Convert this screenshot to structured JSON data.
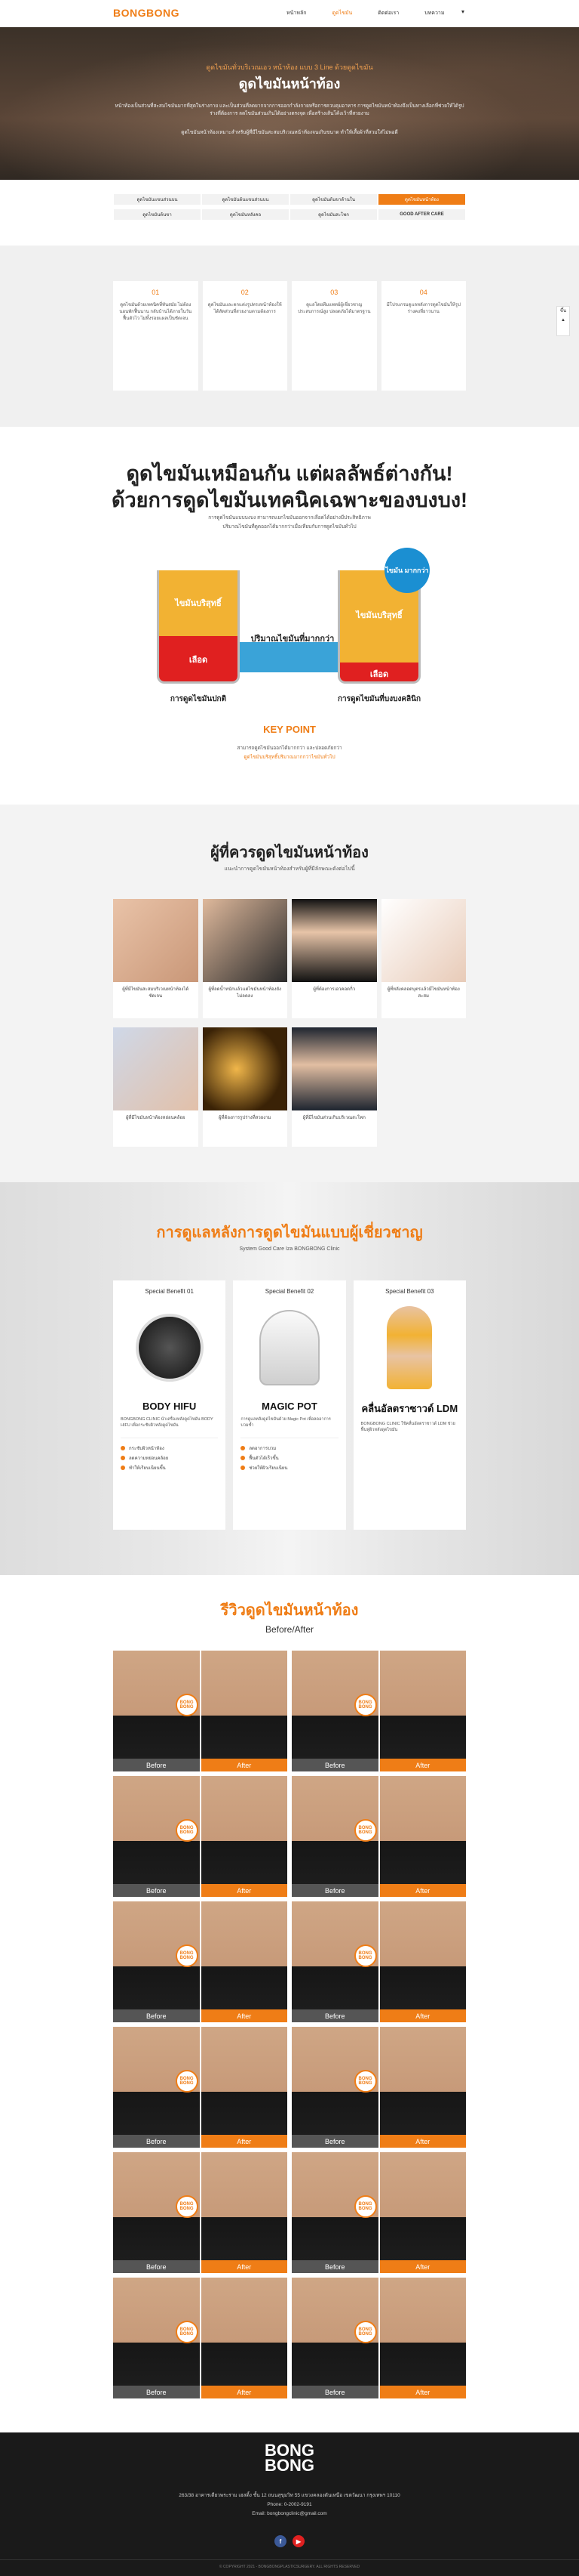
{
  "header": {
    "logo": "BONGBONG",
    "nav": [
      "หน้าหลัก",
      "ดูดไขมัน",
      "ติดต่อเรา",
      "บทความ",
      "▾"
    ]
  },
  "hero": {
    "subtitle": "ดูดไขมันทั่วบริเวณเอว หน้าท้อง แบบ 3 Line ด้วยดูดไขมัน",
    "title": "ดูดไขมันหน้าท้อง",
    "desc1": "หน้าท้องเป็นส่วนที่สะสมไขมันมากที่สุดในร่างกาย และเป็นส่วนที่ลดยากจากการออกกำลังกายหรือการควบคุมอาหาร การดูดไขมันหน้าท้องจึงเป็นทางเลือกที่ช่วยให้ได้รูปร่างที่ต้องการ ลดไขมันส่วนเกินได้อย่างตรงจุด เพื่อสร้างเส้นโค้งเว้าที่สวยงาม",
    "desc2": "ดูดไขมันหน้าท้องเหมาะสำหรับผู้ที่มีไขมันสะสมบริเวณหน้าท้องจนเกินขนาด ทำให้เสื้อผ้าที่สวมใส่ไม่พอดี"
  },
  "tabs": [
    {
      "label": "ดูดไขมันแขนส่วนบน",
      "active": false
    },
    {
      "label": "ดูดไขมันต้นแขนส่วนบน",
      "active": false
    },
    {
      "label": "ดูดไขมันต้นขาด้านใน",
      "active": false
    },
    {
      "label": "ดูดไขมันหน้าท้อง",
      "active": true
    },
    {
      "label": "ดูดไขมันต้นขา",
      "active": false
    },
    {
      "label": "ดูดไขมันหลังคอ",
      "active": false
    },
    {
      "label": "ดูดไขมันสะโพก",
      "active": false
    },
    {
      "label": "GOOD AFTER CARE",
      "active": false
    }
  ],
  "steps": [
    {
      "num": "01",
      "text": "ดูดไขมันด้วยเทคนิคที่ทันสมัย ไม่ต้องนอนพักฟื้นนาน กลับบ้านได้ภายในวัน ฟื้นตัวไว ไม่ทิ้งรอยแผลเป็นชัดเจน"
    },
    {
      "num": "02",
      "text": "ดูดไขมันและตกแต่งรูปทรงหน้าท้องให้ได้สัดส่วนที่สวยงามตามต้องการ"
    },
    {
      "num": "03",
      "text": "ดูแลโดยทีมแพทย์ผู้เชี่ยวชาญ ประสบการณ์สูง ปลอดภัยได้มาตรฐาน"
    },
    {
      "num": "04",
      "text": "มีโปรแกรมดูแลหลังการดูดไขมันให้รูปร่างคงที่ยาวนาน"
    }
  ],
  "side": {
    "up": "ขึ้น",
    "down": "▲"
  },
  "compare": {
    "heading1": "ดูดไขมันเหมือนกัน แต่ผลลัพธ์ต่างกัน!",
    "heading2": "ด้วยการดูดไขมันเทคนิคเฉพาะของบงบง!",
    "p1": "การดูดไขมันแบบบงบง สามารถแยกไขมันออกจากเลือดได้อย่างมีประสิทธิภาพ",
    "p2": "ปริมาณไขมันที่ดูดออกได้มากกว่าเมื่อเทียบกับการดูดไขมันทั่วไป",
    "fat_label": "ไขมันบริสุทธิ์",
    "blood_label": "เลือด",
    "middle_label": "ปริมาณไขมันที่มากกว่า",
    "badge": "ไขมัน มากกว่า",
    "left_caption": "การดูดไขมันปกติ",
    "right_caption": "การดูดไขมันที่บงบงคลินิก",
    "key_point": "KEY POINT",
    "kp_text1": "สามารถดูดไขมันออกได้มากกว่า และปลอดภัยกว่า",
    "kp_text2": "ดูดไขมันบริสุทธิ์ปริมาณมากกว่าไขมันทั่วไป"
  },
  "who": {
    "title": "ผู้ที่ควรดูดไขมันหน้าท้อง",
    "subtitle": "แนะนำการดูดไขมันหน้าท้องสำหรับผู้ที่มีลักษณะดังต่อไปนี้",
    "items": [
      "ผู้ที่มีไขมันสะสมบริเวณหน้าท้องได้ชัดเจน",
      "ผู้ที่ลดน้ำหนักแล้วแต่ไขมันหน้าท้องยังไม่ลดลง",
      "ผู้ที่ต้องการเอวคอดกิ่ว",
      "ผู้ที่หลังคลอดบุตรแล้วมีไขมันหน้าท้องสะสม",
      "ผู้ที่มีไขมันหน้าท้องหย่อนคล้อย",
      "ผู้ที่ต้องการรูปร่างที่สวยงาม",
      "ผู้ที่มีไขมันส่วนเกินบริเวณสะโพก"
    ]
  },
  "care": {
    "title": "การดูแลหลังการดูดไขมันแบบผู้เชี่ยวชาญ",
    "subtitle": "System Good Care Iza BONGBONG Clinic",
    "services": [
      {
        "benefit": "Special Benefit 01",
        "name": "BODY HIFU",
        "desc": "BONGBONG CLINIC นำเครื่องหลังดูดไขมัน BODY HIFU เพื่อกระชับผิวหลังดูดไขมัน",
        "points": [
          "กระชับผิวหน้าท้อง",
          "ลดความหย่อนคล้อย",
          "ทำให้เรียบเนียนขึ้น"
        ]
      },
      {
        "benefit": "Special Benefit 02",
        "name": "MAGIC POT",
        "desc": "การดูแลหลังดูดไขมันด้วย Magic Pot เพื่อลดอาการบวมช้ำ",
        "points": [
          "ลดอาการบวม",
          "ฟื้นตัวได้เร็วขึ้น",
          "ช่วยให้ผิวเรียบเนียน"
        ]
      },
      {
        "benefit": "Special Benefit 03",
        "name": "คลื่นอัลตราซาวด์ LDM",
        "desc": "BONGBONG CLINIC ใช้คลื่นอัลตราซาวด์ LDM ช่วยฟื้นฟูผิวหลังดูดไขมัน",
        "points": []
      }
    ]
  },
  "review": {
    "title": "รีวิวดูดไขมันหน้าท้อง",
    "subtitle": "Before/After",
    "before": "Before",
    "after": "After",
    "stamp": "BONG BONG",
    "count": 12
  },
  "footer": {
    "logo_line1": "BONG",
    "logo_line2": "BONG",
    "addr": "263/38 อาคารเดียวพระราม เฮลดิ้ง ชั้น 12 ถนนสุขุมวิท 55 แขวงคลองตันเหนือ เขตวัฒนา กรุงเทพฯ 10110",
    "phone": "Phone: 0-2002-9191",
    "email": "Email: bongbongclinic@gmail.com",
    "copyright": "© COPYRIGHT 2021 - BONGBONGPLASTICSURGERY. ALL RIGHTS RESERVED"
  }
}
